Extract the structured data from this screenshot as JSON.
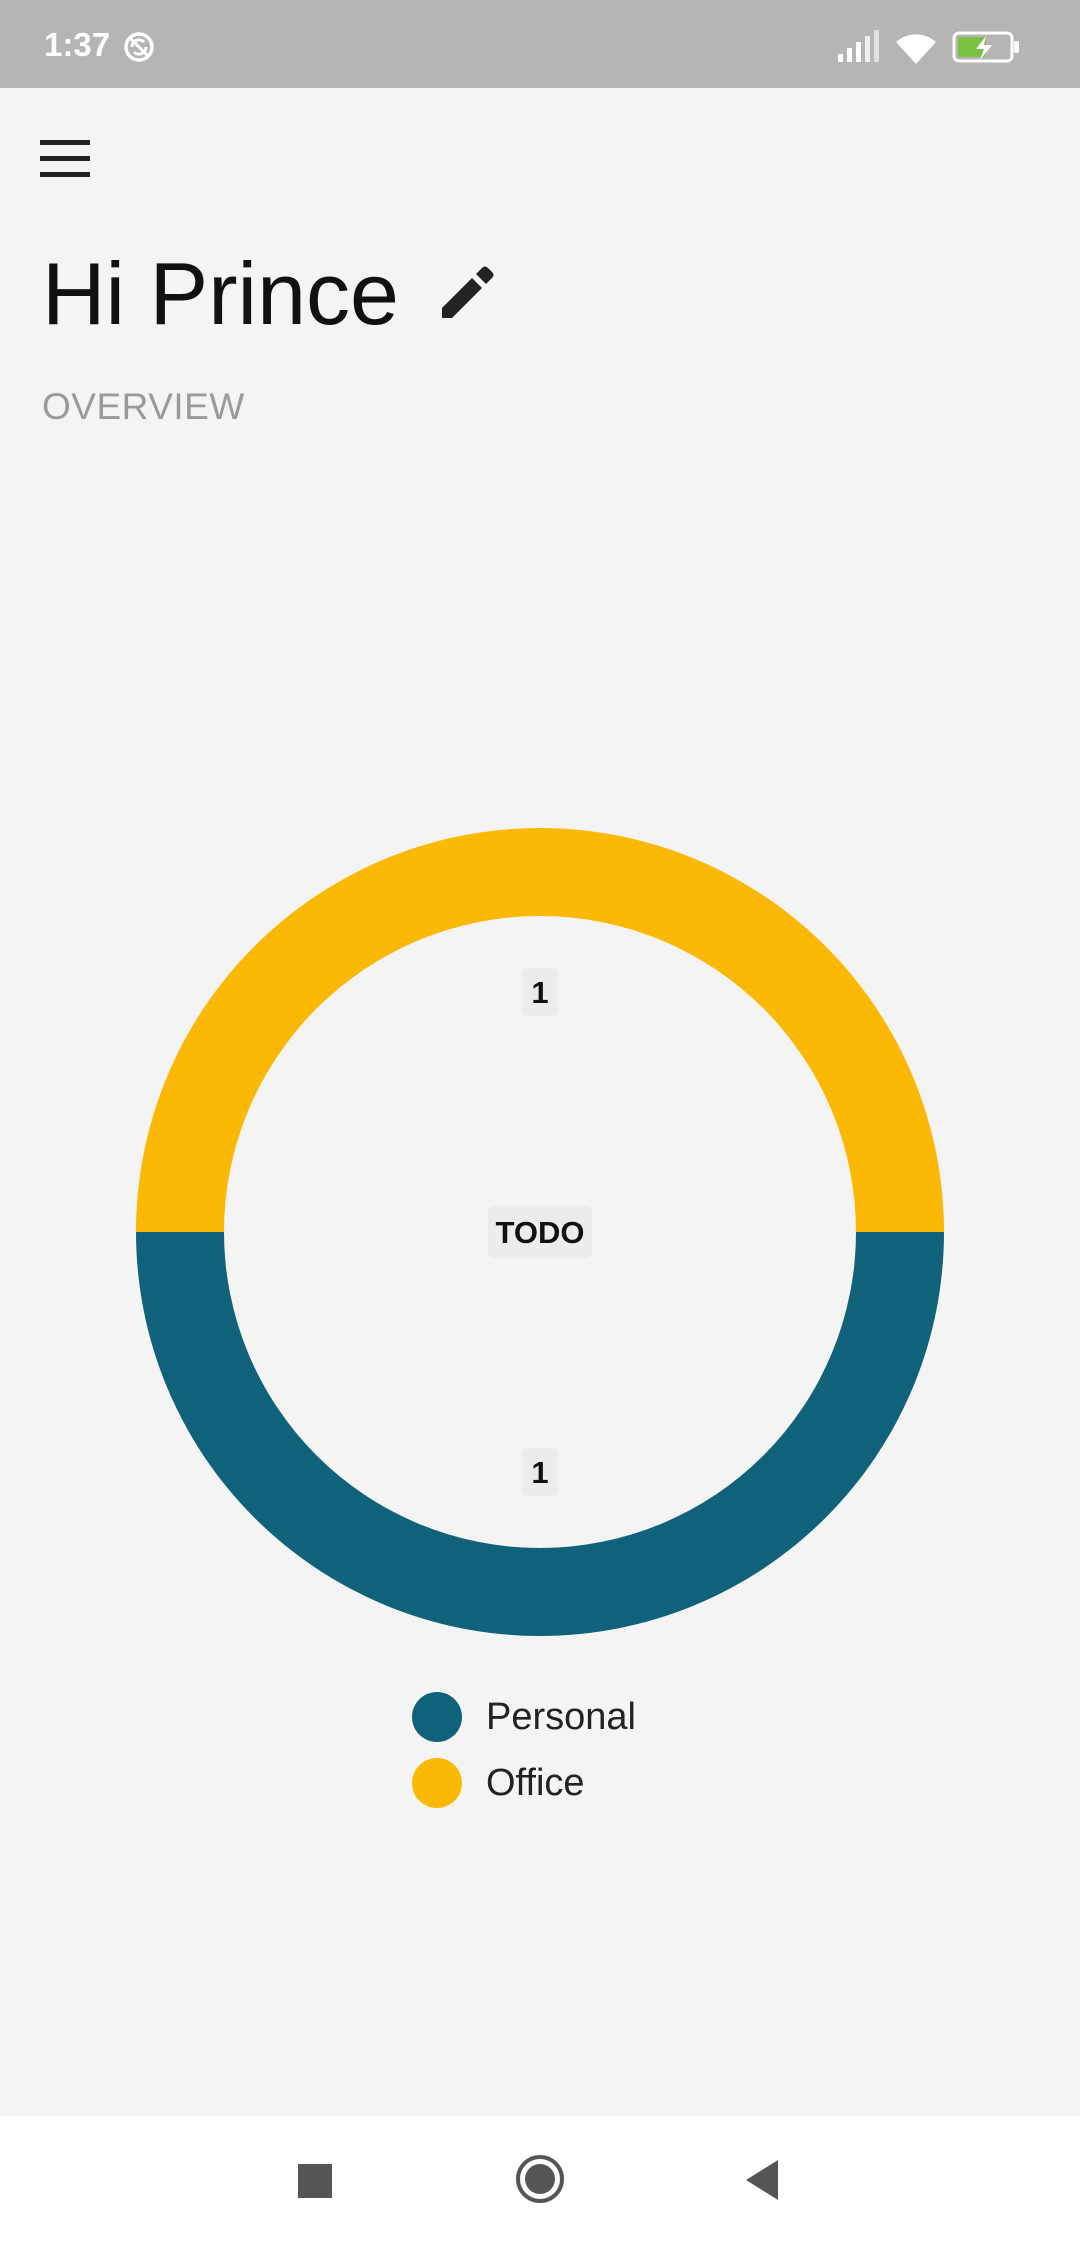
{
  "status_bar": {
    "time": "1:37",
    "icons": [
      "sync-icon",
      "signal-icon",
      "wifi-icon",
      "battery-charging-icon"
    ]
  },
  "header": {
    "menu_icon": "hamburger-menu-icon",
    "greeting": "Hi Prince",
    "edit_icon": "pencil-icon",
    "section_label": "OVERVIEW"
  },
  "colors": {
    "personal": "#10627a",
    "office": "#fbb804",
    "background": "#f4f4f4",
    "label_bg": "#ececec"
  },
  "chart_data": {
    "type": "pie",
    "variant": "donut",
    "center_label": "TODO",
    "categories": [
      "Personal",
      "Office"
    ],
    "values": [
      1,
      1
    ],
    "colors": [
      "#10627a",
      "#fbb804"
    ],
    "legend": "bottom-center"
  },
  "nav_bar": {
    "icons": [
      "recent-apps-icon",
      "home-icon",
      "back-icon"
    ]
  }
}
